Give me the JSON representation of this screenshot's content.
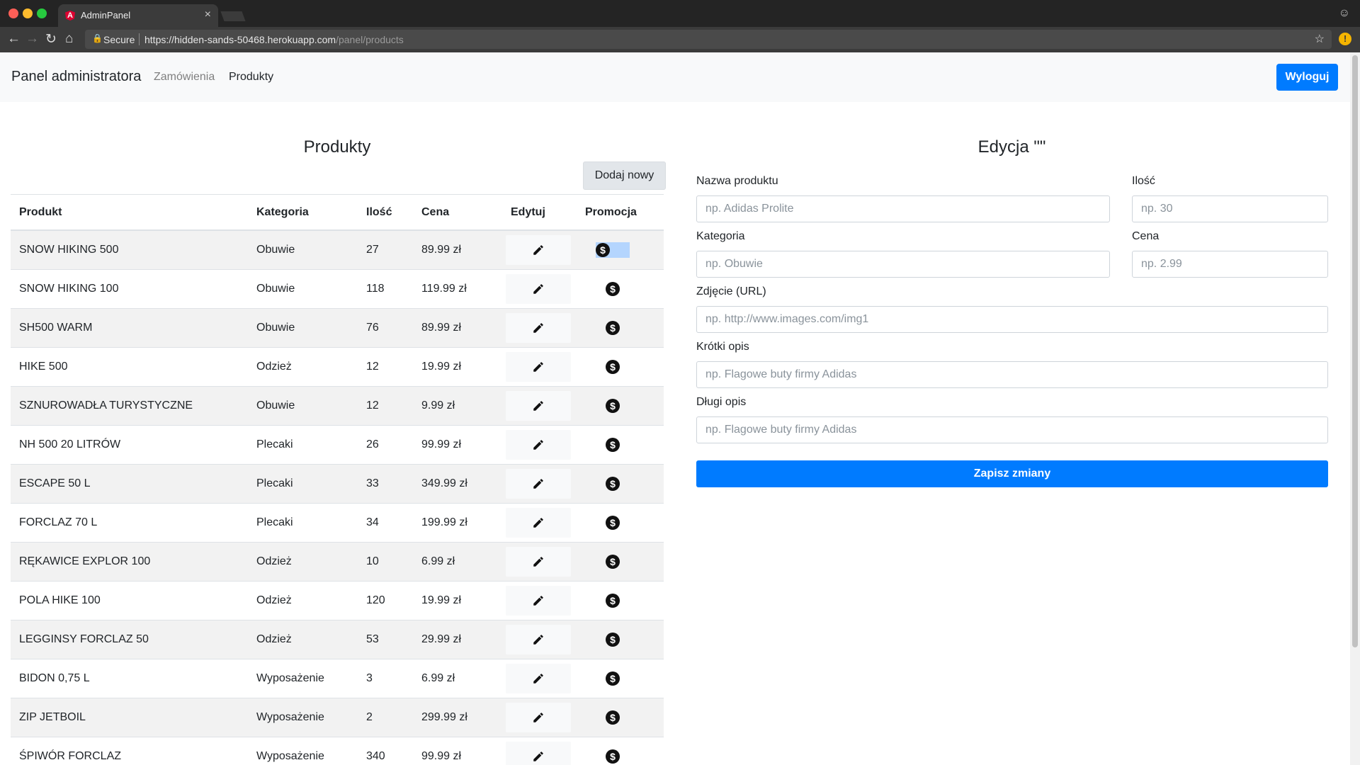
{
  "browser": {
    "tab_title": "AdminPanel",
    "tab_close": "×",
    "secure_label": "Secure",
    "url_host": "https://hidden-sands-50468.herokuapp.com",
    "url_path": "/panel/products"
  },
  "navbar": {
    "brand": "Panel administratora",
    "links": [
      "Zamówienia",
      "Produkty"
    ],
    "active_link": "Produkty",
    "logout": "Wyloguj"
  },
  "products": {
    "title": "Produkty",
    "add_new": "Dodaj nowy",
    "columns": [
      "Produkt",
      "Kategoria",
      "Ilość",
      "Cena",
      "Edytuj",
      "Promocja"
    ],
    "rows": [
      {
        "name": "SNOW HIKING 500",
        "category": "Obuwie",
        "qty": "27",
        "price": "89.99 zł"
      },
      {
        "name": "SNOW HIKING 100",
        "category": "Obuwie",
        "qty": "118",
        "price": "119.99 zł"
      },
      {
        "name": "SH500 WARM",
        "category": "Obuwie",
        "qty": "76",
        "price": "89.99 zł"
      },
      {
        "name": "HIKE 500",
        "category": "Odzież",
        "qty": "12",
        "price": "19.99 zł"
      },
      {
        "name": "SZNUROWADŁA TURYSTYCZNE",
        "category": "Obuwie",
        "qty": "12",
        "price": "9.99 zł"
      },
      {
        "name": "NH 500 20 LITRÓW",
        "category": "Plecaki",
        "qty": "26",
        "price": "99.99 zł"
      },
      {
        "name": "ESCAPE 50 L",
        "category": "Plecaki",
        "qty": "33",
        "price": "349.99 zł"
      },
      {
        "name": "FORCLAZ 70 L",
        "category": "Plecaki",
        "qty": "34",
        "price": "199.99 zł"
      },
      {
        "name": "RĘKAWICE EXPLOR 100",
        "category": "Odzież",
        "qty": "10",
        "price": "6.99 zł"
      },
      {
        "name": "POLA HIKE 100",
        "category": "Odzież",
        "qty": "120",
        "price": "19.99 zł"
      },
      {
        "name": "LEGGINSY FORCLAZ 50",
        "category": "Odzież",
        "qty": "53",
        "price": "29.99 zł"
      },
      {
        "name": "BIDON 0,75 L",
        "category": "Wyposażenie",
        "qty": "3",
        "price": "6.99 zł"
      },
      {
        "name": "ZIP JETBOIL",
        "category": "Wyposażenie",
        "qty": "2",
        "price": "299.99 zł"
      },
      {
        "name": "ŚPIWÓR FORCLAZ",
        "category": "Wyposażenie",
        "qty": "340",
        "price": "99.99 zł"
      }
    ],
    "edit_icon": "pencil-icon",
    "promo_icon": "dollar-icon"
  },
  "edit": {
    "title": "Edycja \"\"",
    "fields": {
      "name": {
        "label": "Nazwa produktu",
        "placeholder": "np. Adidas Prolite"
      },
      "qty": {
        "label": "Ilość",
        "placeholder": "np. 30"
      },
      "category": {
        "label": "Kategoria",
        "placeholder": "np. Obuwie"
      },
      "price": {
        "label": "Cena",
        "placeholder": "np. 2.99"
      },
      "image": {
        "label": "Zdjęcie (URL)",
        "placeholder": "np. http://www.images.com/img1"
      },
      "short_desc": {
        "label": "Krótki opis",
        "placeholder": "np. Flagowe buty firmy Adidas"
      },
      "long_desc": {
        "label": "Długi opis",
        "placeholder": "np. Flagowe buty firmy Adidas"
      }
    },
    "save": "Zapisz zmiany"
  }
}
